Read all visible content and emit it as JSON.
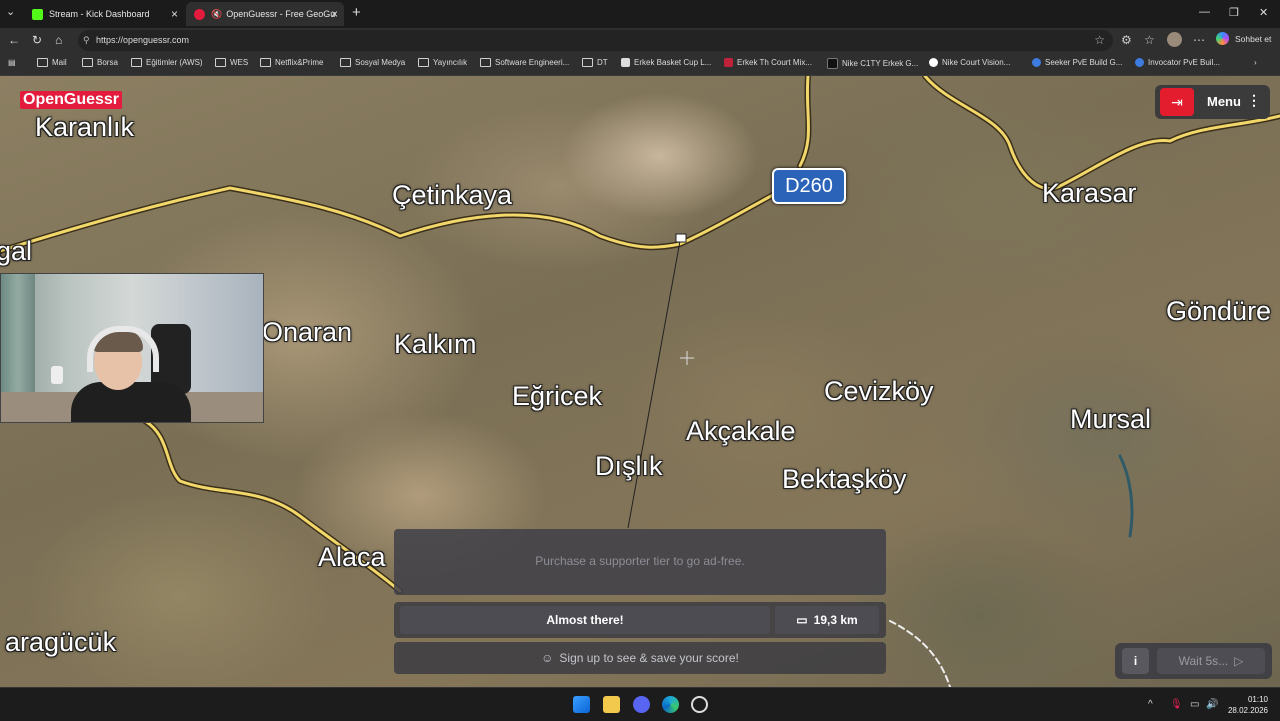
{
  "browser": {
    "tabs": [
      {
        "title": "Stream - Kick Dashboard",
        "favicon_color": "#53fc18"
      },
      {
        "title": "OpenGuessr - Free GeoGuess",
        "favicon_color": "#e31b3c"
      }
    ],
    "url": "https://openguessr.com",
    "profile_button": "Sohbet et",
    "bookmarks": [
      {
        "label": "Mail",
        "kind": "folder"
      },
      {
        "label": "Borsa",
        "kind": "folder"
      },
      {
        "label": "Eğitimler (AWS)",
        "kind": "folder"
      },
      {
        "label": "WES",
        "kind": "folder"
      },
      {
        "label": "Netflix&Prime",
        "kind": "folder"
      },
      {
        "label": "Sosyal Medya",
        "kind": "folder"
      },
      {
        "label": "Yayıncılık",
        "kind": "folder"
      },
      {
        "label": "Software Engineeri...",
        "kind": "folder"
      },
      {
        "label": "DT",
        "kind": "folder"
      },
      {
        "label": "Erkek Basket Cup L...",
        "kind": "site",
        "color": "#ddd"
      },
      {
        "label": "Erkek Th Court Mix...",
        "kind": "site",
        "color": "#c0223a"
      },
      {
        "label": "Nike C1TY Erkek G...",
        "kind": "site",
        "color": "#111"
      },
      {
        "label": "Nike Court Vision...",
        "kind": "site",
        "color": "#fff"
      },
      {
        "label": "Seeker PvE Build G...",
        "kind": "site",
        "color": "#3d7be0"
      },
      {
        "label": "Invocator PvE Buil...",
        "kind": "site",
        "color": "#3d7be0"
      }
    ]
  },
  "game": {
    "logo": "OpenGuessr",
    "menu_label": "Menu",
    "road_sign": "D260",
    "places": [
      {
        "name": "Karanlık"
      },
      {
        "name": "Çetinkaya"
      },
      {
        "name": "Karasar"
      },
      {
        "name": "gal"
      },
      {
        "name": "Göndüre"
      },
      {
        "name": "Onaran"
      },
      {
        "name": "Kalkım"
      },
      {
        "name": "Eğricek"
      },
      {
        "name": "Cevizköy"
      },
      {
        "name": "Mursal"
      },
      {
        "name": "Akçakale"
      },
      {
        "name": "Dışlık"
      },
      {
        "name": "Bektaşköy"
      },
      {
        "name": "Alaca"
      },
      {
        "name": "aragücük"
      }
    ],
    "ad_text": "Purchase a supporter tier to go ad-free.",
    "result_label": "Almost there!",
    "distance": "19,3 km",
    "signup_text": "Sign up to see & save your score!",
    "wait_label": "Wait 5s..."
  },
  "taskbar": {
    "time": "01:10",
    "date": "28.02.2026"
  },
  "colors": {
    "accent_red": "#e31b3c",
    "road_yellow": "#f2d76b",
    "road_sign_blue": "#2a63b8"
  }
}
